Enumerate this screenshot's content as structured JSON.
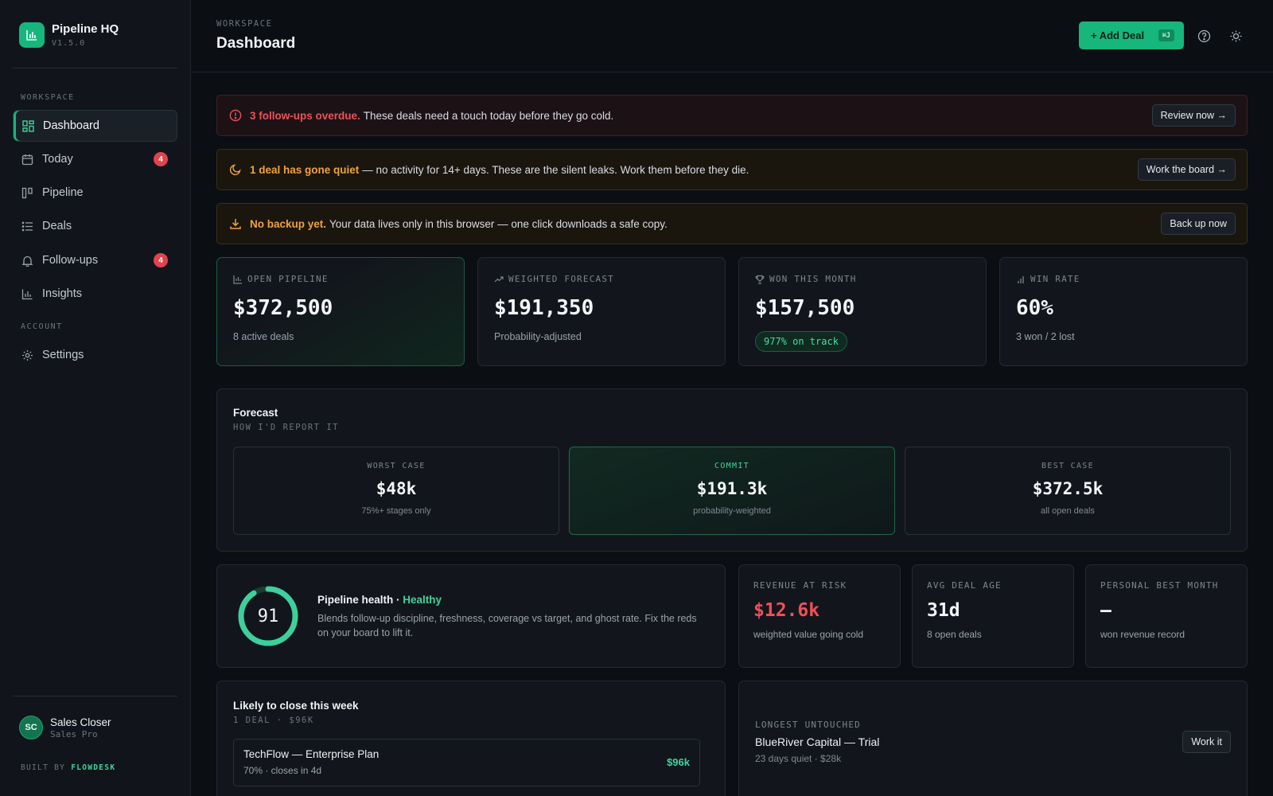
{
  "brand": {
    "name": "Pipeline HQ",
    "version": "V1.5.0"
  },
  "sidebar": {
    "section_workspace": "WORKSPACE",
    "section_account": "ACCOUNT",
    "items": [
      {
        "label": "Dashboard",
        "icon": "dashboard-icon",
        "active": true
      },
      {
        "label": "Today",
        "icon": "calendar-icon",
        "badge": "4"
      },
      {
        "label": "Pipeline",
        "icon": "kanban-icon"
      },
      {
        "label": "Deals",
        "icon": "list-icon"
      },
      {
        "label": "Follow-ups",
        "icon": "bell-icon",
        "badge": "4"
      },
      {
        "label": "Insights",
        "icon": "bar-chart-icon"
      }
    ],
    "settings_label": "Settings",
    "user": {
      "initials": "SC",
      "name": "Sales Closer",
      "role": "Sales Pro"
    },
    "built_by_prefix": "BUILT BY",
    "built_by_name": "FLOWDESK"
  },
  "header": {
    "eyebrow": "WORKSPACE",
    "title": "Dashboard",
    "add_button": "+ Add Deal",
    "add_shortcut": "⌘J"
  },
  "alerts": [
    {
      "strong": "3 follow-ups overdue.",
      "text": "These deals need a touch today before they go cold.",
      "button": "Review now →",
      "tone": "#ef5059"
    },
    {
      "strong": "1 deal has gone quiet",
      "text": "— no activity for 14+ days. These are the silent leaks. Work them before they die.",
      "button": "Work the board →",
      "tone": "#f0a23a"
    },
    {
      "strong": "No backup yet.",
      "text": "Your data lives only in this browser — one click downloads a safe copy.",
      "button": "Back up now",
      "tone": "#f0a23a"
    }
  ],
  "stats": [
    {
      "label": "OPEN PIPELINE",
      "value": "$372,500",
      "sub": "8 active deals"
    },
    {
      "label": "WEIGHTED FORECAST",
      "value": "$191,350",
      "sub": "Probability-adjusted"
    },
    {
      "label": "WON THIS MONTH",
      "value": "$157,500",
      "pill": "977% on track"
    },
    {
      "label": "WIN RATE",
      "value": "60%",
      "sub": "3 won / 2 lost"
    }
  ],
  "forecast": {
    "title": "Forecast",
    "subtitle": "HOW I'D REPORT IT",
    "boxes": [
      {
        "label": "WORST CASE",
        "value": "$48k",
        "sub": "75%+ stages only"
      },
      {
        "label": "COMMIT",
        "value": "$191.3k",
        "sub": "probability-weighted"
      },
      {
        "label": "BEST CASE",
        "value": "$372.5k",
        "sub": "all open deals"
      }
    ]
  },
  "health": {
    "score": "91",
    "score_fraction": 0.91,
    "title": "Pipeline health ·",
    "status": "Healthy",
    "description": "Blends follow-up discipline, freshness, coverage vs target, and ghost rate. Fix the reds on your board to lift it."
  },
  "metrics": [
    {
      "label": "REVENUE AT RISK",
      "value": "$12.6k",
      "sub": "weighted value going cold"
    },
    {
      "label": "AVG DEAL AGE",
      "value": "31d",
      "sub": "8 open deals"
    },
    {
      "label": "PERSONAL BEST MONTH",
      "value": "—",
      "sub": "won revenue record"
    }
  ],
  "likely_close": {
    "title": "Likely to close this week",
    "subtitle": "1 DEAL · $96K",
    "deal": {
      "name": "TechFlow — Enterprise Plan",
      "meta": "70% · closes in 4d",
      "amount": "$96k"
    }
  },
  "longest_untouched": {
    "label": "LONGEST UNTOUCHED",
    "name": "BlueRiver Capital — Trial",
    "meta": "23 days quiet · $28k",
    "button": "Work it"
  },
  "colors": {
    "accent": "#16b67c",
    "danger": "#ef5059",
    "warning": "#f0a23a",
    "background": "#0b0e12"
  }
}
